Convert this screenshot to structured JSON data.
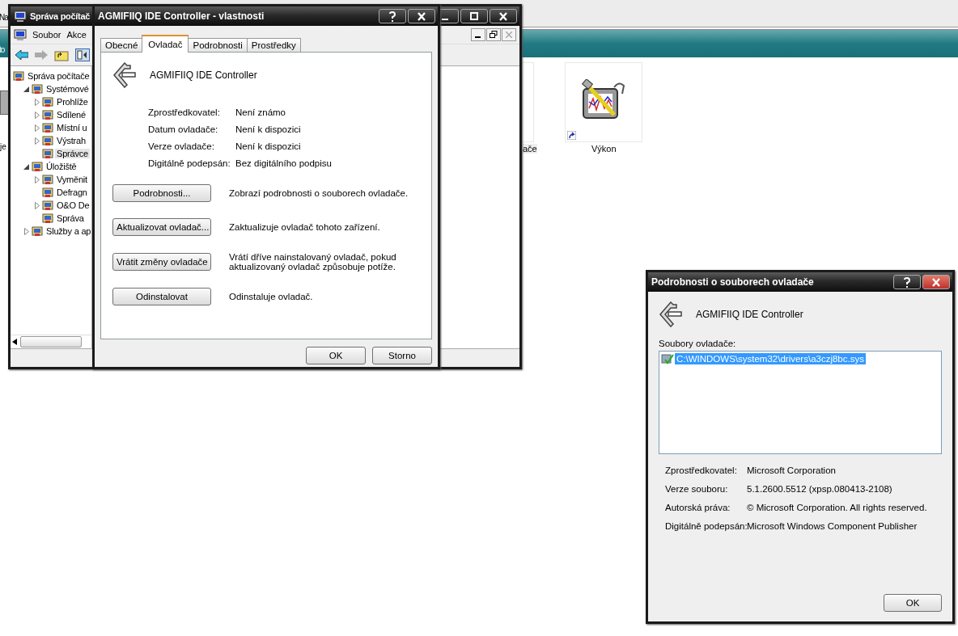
{
  "desktop": {
    "edge_texts": [
      "Na",
      "to",
      "je"
    ],
    "tiles": [
      {
        "label": "ače"
      },
      {
        "label": "Výkon"
      }
    ]
  },
  "console": {
    "title": "Správa počítač",
    "menu": [
      "Soubor",
      "Akce"
    ],
    "tree": [
      {
        "label": "Správa počítače",
        "selected": false,
        "children": [
          {
            "label": "Systémové",
            "selected": false,
            "expanded": true,
            "children": [
              {
                "label": "Prohlíže",
                "selected": false,
                "expanded": false
              },
              {
                "label": "Sdílené",
                "selected": false,
                "expanded": false
              },
              {
                "label": "Místní u",
                "selected": false,
                "expanded": false
              },
              {
                "label": "Výstrah",
                "selected": false,
                "expanded": false
              },
              {
                "label": "Správce",
                "selected": true
              }
            ]
          },
          {
            "label": "Úložiště",
            "selected": false,
            "expanded": true,
            "children": [
              {
                "label": "Vyměnit",
                "selected": false,
                "expanded": false
              },
              {
                "label": "Defragn",
                "selected": false
              },
              {
                "label": "O&O De",
                "selected": false,
                "expanded": false
              },
              {
                "label": "Správa",
                "selected": false
              }
            ]
          },
          {
            "label": "Služby a ap",
            "selected": false,
            "expanded": false
          }
        ]
      }
    ]
  },
  "properties": {
    "title": "AGMIFIIQ IDE Controller - vlastnosti",
    "tabs": [
      {
        "label": "Obecné",
        "selected": false
      },
      {
        "label": "Ovladač",
        "selected": true
      },
      {
        "label": "Podrobnosti",
        "selected": false
      },
      {
        "label": "Prostředky",
        "selected": false
      }
    ],
    "device_name": "AGMIFIIQ IDE Controller",
    "fields": [
      {
        "label": "Zprostředkovatel:",
        "value": "Není známo"
      },
      {
        "label": "Datum ovladače:",
        "value": "Není k dispozici"
      },
      {
        "label": "Verze ovladače:",
        "value": "Není k dispozici"
      },
      {
        "label": "Digitálně podepsán:",
        "value": "Bez digitálního podpisu"
      }
    ],
    "actions": [
      {
        "button": "Podrobnosti...",
        "description": "Zobrazí podrobnosti o souborech ovladače."
      },
      {
        "button": "Aktualizovat ovladač...",
        "description": "Zaktualizuje ovladač tohoto zařízení."
      },
      {
        "button": "Vrátit změny ovladače",
        "description": "Vrátí dříve nainstalovaný ovladač, pokud aktualizovaný ovladač způsobuje potíže."
      },
      {
        "button": "Odinstalovat",
        "description": "Odinstaluje ovladač."
      }
    ],
    "buttons": [
      "OK",
      "Storno"
    ]
  },
  "file_details": {
    "title": "Podrobnosti o souborech ovladače",
    "device_name": "AGMIFIIQ IDE Controller",
    "files_label": "Soubory ovladače:",
    "files": [
      {
        "path": "C:\\WINDOWS\\system32\\drivers\\a3czj8bc.sys",
        "selected": true
      }
    ],
    "fields": [
      {
        "label": "Zprostředkovatel:",
        "value": "Microsoft Corporation"
      },
      {
        "label": "Verze souboru:",
        "value": "5.1.2600.5512 (xpsp.080413-2108)"
      },
      {
        "label": "Autorská práva:",
        "value": "© Microsoft Corporation. All rights reserved."
      },
      {
        "label": "Digitálně podepsán:",
        "value": "Microsoft Windows Component Publisher"
      }
    ],
    "buttons": [
      "OK"
    ]
  }
}
